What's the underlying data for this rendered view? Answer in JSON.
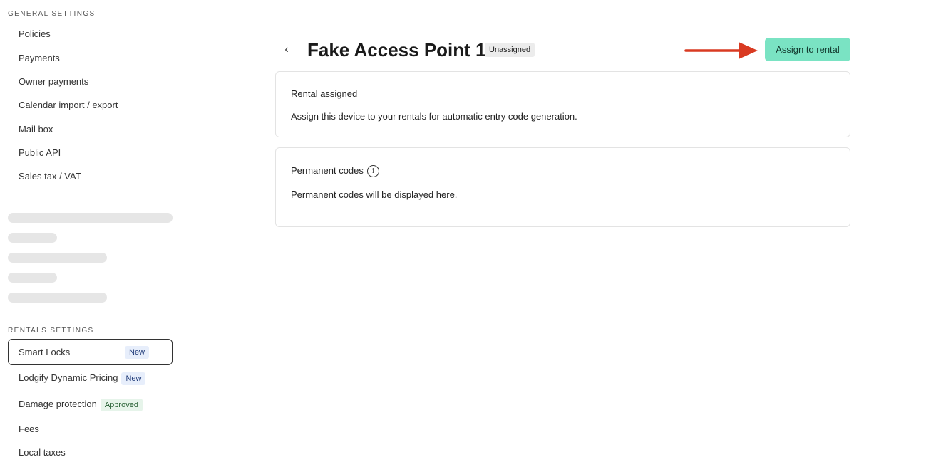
{
  "sidebar": {
    "general_heading": "GENERAL SETTINGS",
    "general_items": [
      {
        "label": "Policies"
      },
      {
        "label": "Payments"
      },
      {
        "label": "Owner payments"
      },
      {
        "label": "Calendar import / export"
      },
      {
        "label": "Mail box"
      },
      {
        "label": "Public API"
      },
      {
        "label": "Sales tax / VAT"
      }
    ],
    "rentals_heading": "RENTALS SETTINGS",
    "rentals_items": [
      {
        "label": "Smart Locks",
        "badge": "New",
        "active": true
      },
      {
        "label": "Lodgify Dynamic Pricing",
        "badge": "New"
      },
      {
        "label": "Damage protection",
        "badge": "Approved"
      },
      {
        "label": "Fees"
      },
      {
        "label": "Local taxes"
      }
    ]
  },
  "header": {
    "back_icon": "chevron-left-icon",
    "title": "Fake Access Point 1",
    "status": "Unassigned",
    "primary_action": "Assign to rental",
    "annotation_arrow_color": "#d93a22"
  },
  "cards": {
    "rental": {
      "title": "Rental assigned",
      "body": "Assign this device to your rentals for automatic entry code generation."
    },
    "permanent": {
      "title": "Permanent codes",
      "info_icon": "info-icon",
      "info_glyph": "i",
      "body": "Permanent codes will be displayed here."
    }
  },
  "colors": {
    "primary_button": "#7ae3c3",
    "badge_new_bg": "#e7eefb",
    "badge_approved_bg": "#e6f4ea"
  }
}
